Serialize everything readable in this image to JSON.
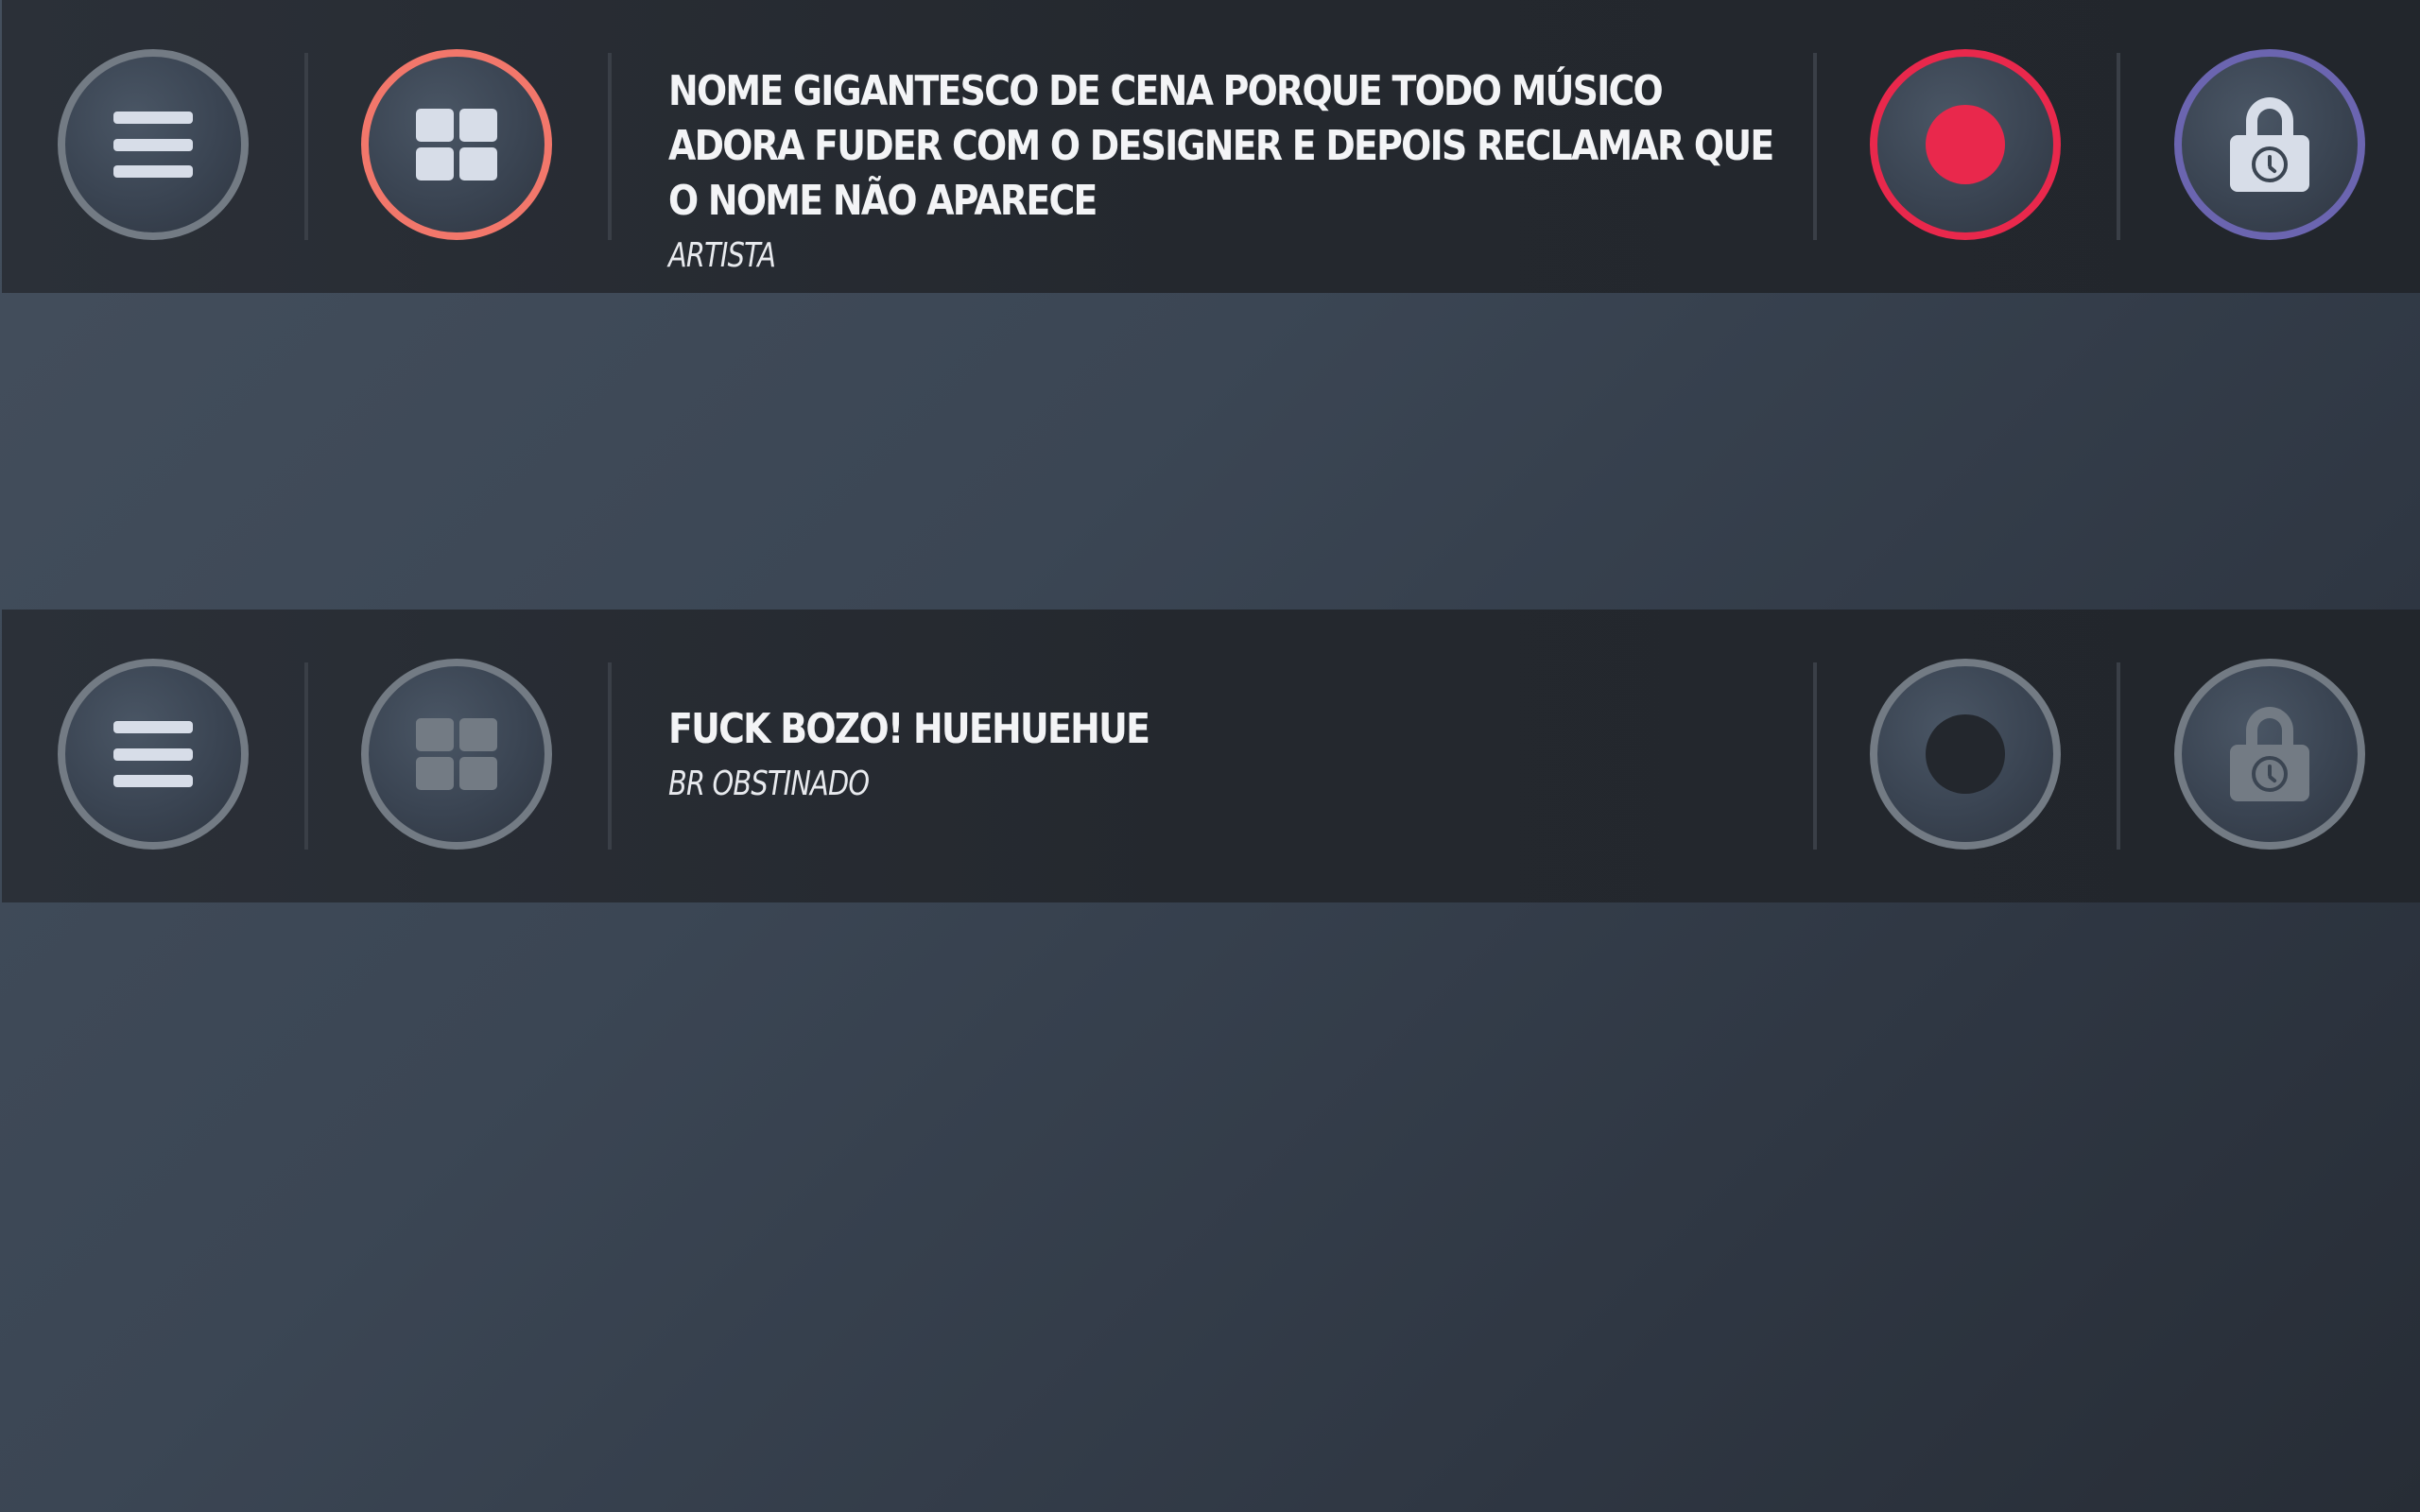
{
  "colors": {
    "grid_active_ring": "#f2776b",
    "record_active": "#e9284c",
    "lock_active_ring": "#6b65b0",
    "inactive_ring": "#737b84",
    "icon_light": "#d7dde8"
  },
  "scenes": [
    {
      "title": "NOME GIGANTESCO DE CENA PORQUE TODO MÚSICO ADORA FUDER COM O DESIGNER E DEPOIS RECLAMAR QUE O NOME NÃO APARECE",
      "artist": "ARTISTA",
      "grid_active": true,
      "record_active": true,
      "lock_active": true,
      "icons": [
        "menu-icon",
        "grid-icon",
        "record-icon",
        "lock-clock-icon"
      ]
    },
    {
      "title": "FUCK BOZO! HUEHUEHUE",
      "artist": "BR OBSTINADO",
      "grid_active": false,
      "record_active": false,
      "lock_active": false,
      "icons": [
        "menu-icon",
        "grid-icon",
        "record-icon",
        "lock-clock-icon"
      ]
    }
  ]
}
